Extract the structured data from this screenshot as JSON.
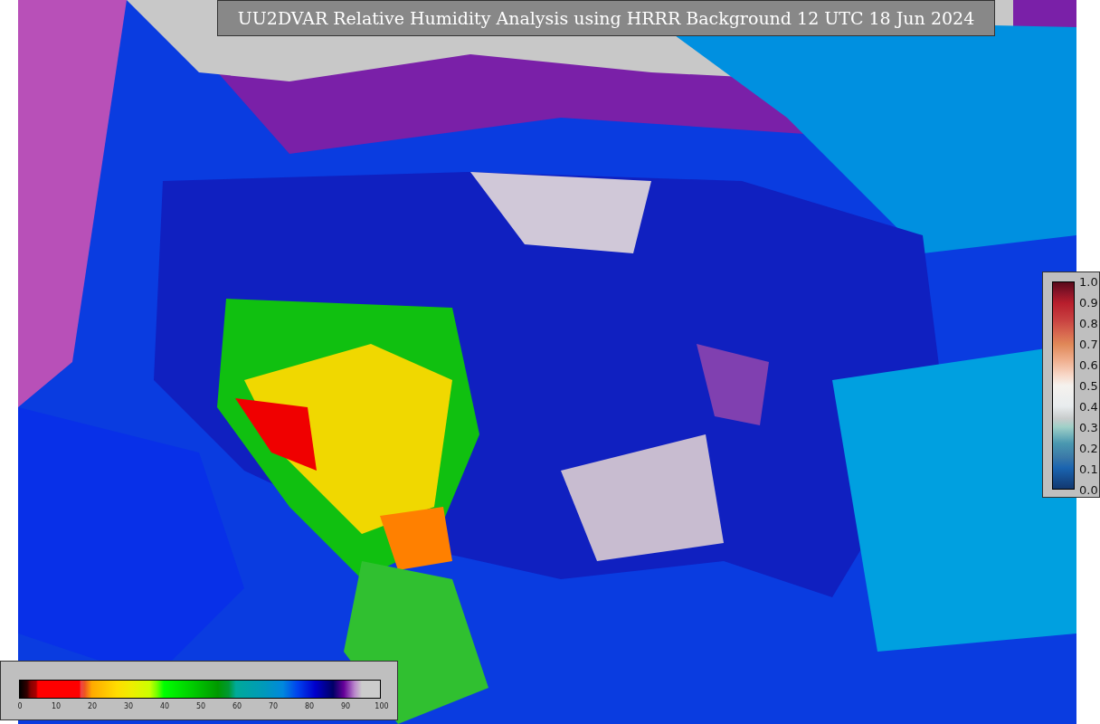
{
  "title": "UU2DVAR Relative Humidity Analysis using HRRR Background 12 UTC 18 Jun 2024",
  "bottom_colorbar": {
    "ticks": [
      "0",
      "10",
      "20",
      "30",
      "40",
      "50",
      "60",
      "70",
      "80",
      "90",
      "100"
    ]
  },
  "side_colorbar": {
    "ticks": [
      "1.0",
      "0.9",
      "0.8",
      "0.7",
      "0.6",
      "0.5",
      "0.4",
      "0.3",
      "0.2",
      "0.1",
      "0.0"
    ]
  }
}
